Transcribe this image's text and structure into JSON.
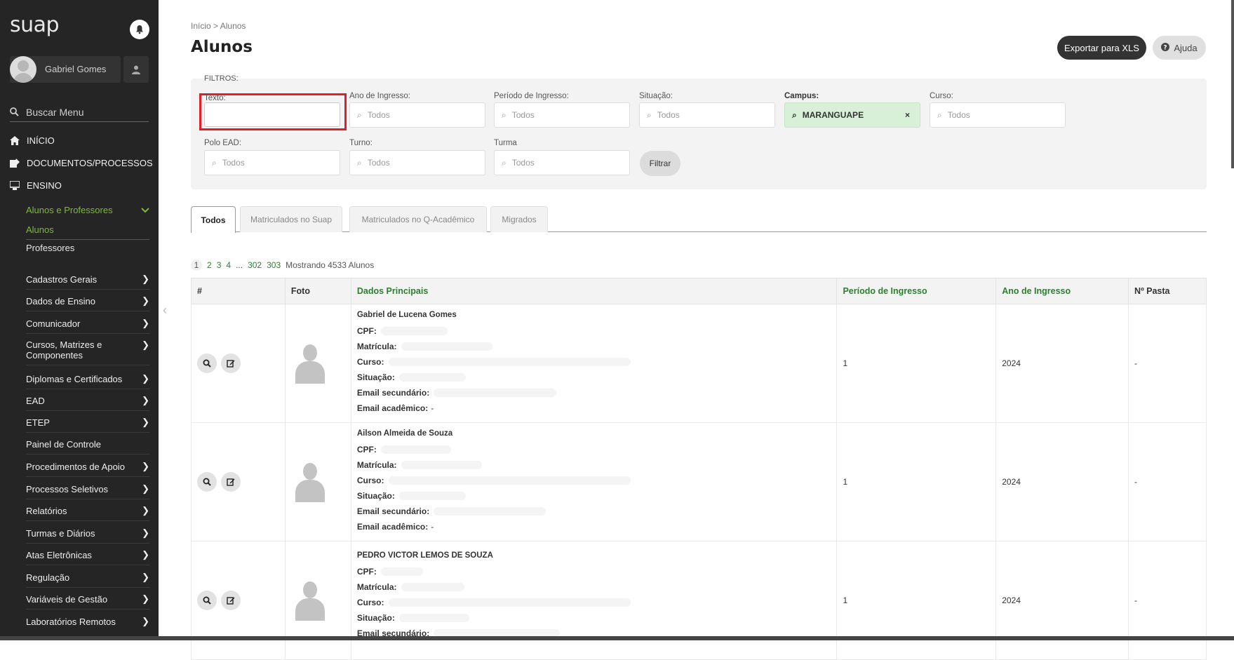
{
  "app": {
    "logo": "suap"
  },
  "sidebar": {
    "user_name": "Gabriel Gomes",
    "search_label": "Buscar Menu",
    "main_items": [
      {
        "label": "INÍCIO",
        "icon": "home-icon"
      },
      {
        "label": "DOCUMENTOS/PROCESSOS",
        "icon": "document-icon"
      },
      {
        "label": "ENSINO",
        "icon": "teaching-icon"
      }
    ],
    "submenu_open": "Alunos e Professores",
    "submenu_items": [
      "Alunos",
      "Professores"
    ],
    "menu_items": [
      "Cadastros Gerais",
      "Dados de Ensino",
      "Comunicador",
      "Cursos, Matrizes e Componentes",
      "Diplomas e Certificados",
      "EAD",
      "ETEP",
      "Painel de Controle",
      "Procedimentos de Apoio",
      "Processos Seletivos",
      "Relatórios",
      "Turmas e Diários",
      "Atas Eletrônicas",
      "Regulação",
      "Variáveis de Gestão",
      "Laboratórios Remotos"
    ]
  },
  "header": {
    "breadcrumb_home": "Início",
    "breadcrumb_sep": ">",
    "breadcrumb_current": "Alunos",
    "title": "Alunos",
    "export_label": "Exportar para XLS",
    "help_label": "Ajuda"
  },
  "filters": {
    "title": "FILTROS:",
    "texto_label": "Texto:",
    "texto_value": "",
    "ano_label": "Ano de Ingresso:",
    "ano_value": "Todos",
    "periodo_label": "Período de Ingresso:",
    "periodo_value": "Todos",
    "situacao_label": "Situação:",
    "situacao_value": "Todos",
    "campus_label": "Campus:",
    "campus_value": "MARANGUAPE",
    "curso_label": "Curso:",
    "curso_value": "Todos",
    "polo_label": "Polo EAD:",
    "polo_value": "Todos",
    "turno_label": "Turno:",
    "turno_value": "Todos",
    "turma_label": "Turma",
    "turma_value": "Todos",
    "filter_button": "Filtrar",
    "highlight_color": "#e41e26"
  },
  "tabs": [
    "Todos",
    "Matriculados no Suap",
    "Matriculados no Q-Acadêmico",
    "Migrados"
  ],
  "pagination": {
    "current": "1",
    "pages": [
      "2",
      "3",
      "4",
      "...",
      "302",
      "303"
    ],
    "summary": "Mostrando 4533 Alunos"
  },
  "table": {
    "columns": [
      "#",
      "Foto",
      "Dados Principais",
      "Período de Ingresso",
      "Ano de Ingresso",
      "Nº Pasta"
    ],
    "field_labels": {
      "cpf": "CPF:",
      "matricula": "Matrícula:",
      "curso": "Curso:",
      "situacao": "Situação:",
      "email_sec": "Email secundário:",
      "email_acad": "Email acadêmico:"
    },
    "rows": [
      {
        "name": "Gabriel de Lucena Gomes",
        "email_acad": "-",
        "periodo": "1",
        "ano": "2024",
        "pasta": "-"
      },
      {
        "name": "Ailson Almeida de Souza",
        "email_acad": "-",
        "periodo": "1",
        "ano": "2024",
        "pasta": "-"
      },
      {
        "name": "PEDRO VICTOR LEMOS DE SOUZA",
        "email_acad": "",
        "periodo": "1",
        "ano": "2024",
        "pasta": "-"
      }
    ]
  },
  "colors": {
    "sidebar_bg": "#252525",
    "accent_green": "#79bb3a",
    "link_green": "#2e7d32",
    "campus_bg": "#d8f0d8"
  }
}
